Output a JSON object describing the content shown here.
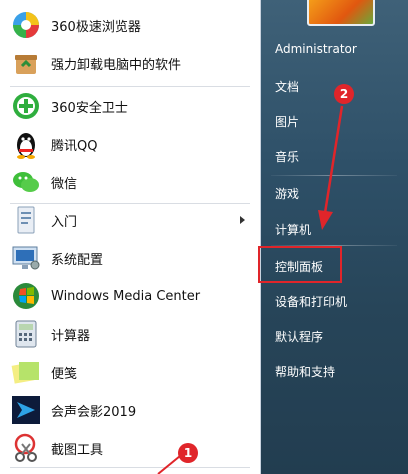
{
  "programs": [
    {
      "label": "360极速浏览器",
      "icon": "360-browser-icon"
    },
    {
      "label": "强力卸载电脑中的软件",
      "icon": "uninstall-box-icon"
    },
    {
      "label": "360安全卫士",
      "icon": "360-security-icon"
    },
    {
      "label": "腾讯QQ",
      "icon": "qq-penguin-icon"
    },
    {
      "label": "微信",
      "icon": "wechat-icon"
    },
    {
      "label": "入门",
      "icon": "getting-started-icon"
    },
    {
      "label": "系统配置",
      "icon": "system-config-icon"
    },
    {
      "label": "Windows Media Center",
      "icon": "media-center-icon"
    },
    {
      "label": "计算器",
      "icon": "calculator-icon"
    },
    {
      "label": "便笺",
      "icon": "sticky-note-icon"
    },
    {
      "label": "会声会影2019",
      "icon": "video-studio-icon"
    },
    {
      "label": "截图工具",
      "icon": "snipping-tool-icon"
    }
  ],
  "right_menu": {
    "user": "Administrator",
    "documents": "文档",
    "pictures": "图片",
    "music": "音乐",
    "games": "游戏",
    "computer": "计算机",
    "control_panel": "控制面板",
    "devices_printers": "设备和打印机",
    "default_programs": "默认程序",
    "help_support": "帮助和支持"
  },
  "annotations": {
    "badge1": "1",
    "badge2": "2"
  },
  "colors": {
    "highlight": "#e0252a",
    "right_panel": "#2e5068"
  }
}
